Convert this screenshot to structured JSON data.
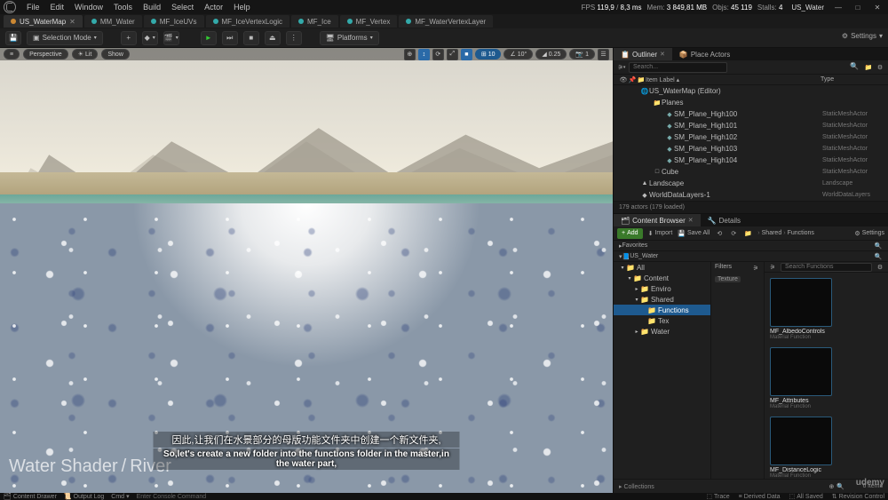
{
  "menubar": [
    "File",
    "Edit",
    "Window",
    "Tools",
    "Build",
    "Select",
    "Actor",
    "Help"
  ],
  "perf": {
    "fps": "119,9",
    "ms": "8,3 ms",
    "mem": "3 849,81 MB",
    "objs": "45 119",
    "stalls": "4",
    "project": "US_Water"
  },
  "win": {
    "min": "—",
    "max": "□",
    "close": "✕"
  },
  "tabs": [
    {
      "label": "US_WaterMap",
      "active": true,
      "dot": "orange"
    },
    {
      "label": "MM_Water",
      "dot": "teal"
    },
    {
      "label": "MF_IceUVs",
      "dot": "teal"
    },
    {
      "label": "MF_IceVertexLogic",
      "dot": "teal"
    },
    {
      "label": "MF_Ice",
      "dot": "teal"
    },
    {
      "label": "MF_Vertex",
      "dot": "teal"
    },
    {
      "label": "MF_WaterVertexLayer",
      "dot": "teal"
    }
  ],
  "toolbar": {
    "save_icon": "💾",
    "mode": "Selection Mode",
    "add": "+",
    "play": "►",
    "pause": "❚❚",
    "stop": "■",
    "step": "⏭",
    "eject": "⏏",
    "platforms": "Platforms",
    "three": "⋮",
    "settings": "Settings"
  },
  "viewport": {
    "menu": "≡",
    "perspective": "Perspective",
    "lit": "Lit",
    "show": "Show",
    "r_icons": [
      "⊕",
      "↕",
      "⟳",
      "⤢",
      "■"
    ],
    "r_vals": [
      "10",
      "",
      "10°",
      "0.25",
      "1"
    ],
    "r_tail": [
      "📷",
      "☰"
    ]
  },
  "outliner": {
    "tab1": "Outliner",
    "tab2": "Place Actors",
    "filter": "⚙",
    "search_ph": "Search...",
    "settings": "⚙",
    "new": "📁",
    "col_icons": [
      "👁",
      "📌",
      "📁"
    ],
    "col_label": "Item Label",
    "col_type": "Type",
    "rows": [
      {
        "ind": 30,
        "ico": "🌐",
        "name": "US_WaterMap (Editor)",
        "type": ""
      },
      {
        "ind": 44,
        "ico": "📁",
        "cls": "folder-ico",
        "name": "Planes",
        "type": ""
      },
      {
        "ind": 58,
        "ico": "◆",
        "cls": "mesh-ico",
        "name": "SM_Plane_High100",
        "type": "StaticMeshActor"
      },
      {
        "ind": 58,
        "ico": "◆",
        "cls": "mesh-ico",
        "name": "SM_Plane_High101",
        "type": "StaticMeshActor"
      },
      {
        "ind": 58,
        "ico": "◆",
        "cls": "mesh-ico",
        "name": "SM_Plane_High102",
        "type": "StaticMeshActor"
      },
      {
        "ind": 58,
        "ico": "◆",
        "cls": "mesh-ico",
        "name": "SM_Plane_High103",
        "type": "StaticMeshActor"
      },
      {
        "ind": 58,
        "ico": "◆",
        "cls": "mesh-ico",
        "name": "SM_Plane_High104",
        "type": "StaticMeshActor"
      },
      {
        "ind": 44,
        "ico": "□",
        "name": "Cube",
        "type": "StaticMeshActor"
      },
      {
        "ind": 30,
        "ico": "▲",
        "name": "Landscape",
        "type": "Landscape"
      },
      {
        "ind": 30,
        "ico": "◆",
        "name": "WorldDataLayers-1",
        "type": "WorldDataLayers"
      }
    ],
    "status": "179 actors (179 loaded)"
  },
  "cb": {
    "tab1": "Content Browser",
    "tab2": "Details",
    "add": "Add",
    "import": "Import",
    "save_all": "Save All",
    "settings": "Settings",
    "crumbs": [
      "Shared",
      "Functions"
    ],
    "fav": "Favorites",
    "root": "US_Water",
    "tree": [
      {
        "ind": 6,
        "arr": "▾",
        "name": "All"
      },
      {
        "ind": 14,
        "arr": "▾",
        "name": "Content"
      },
      {
        "ind": 22,
        "arr": "▸",
        "name": "Enviro"
      },
      {
        "ind": 22,
        "arr": "▾",
        "name": "Shared"
      },
      {
        "ind": 30,
        "arr": "",
        "name": "Functions",
        "sel": true
      },
      {
        "ind": 30,
        "arr": "",
        "name": "Tex"
      },
      {
        "ind": 22,
        "arr": "▸",
        "name": "Water"
      }
    ],
    "filters_label": "Filters",
    "filter_chip": "Texture",
    "asset_search": "Search Functions",
    "assets": [
      {
        "name": "MF_AlbedoControls",
        "type": "Material Function"
      },
      {
        "name": "MF_Attributes",
        "type": "Material Function"
      },
      {
        "name": "MF_DistanceLogic",
        "type": "Material Function"
      }
    ],
    "collections": "Collections",
    "count": "6 items"
  },
  "statusbar": {
    "drawer": "Content Drawer",
    "output": "Output Log",
    "cmd": "Cmd",
    "cmd_ph": "Enter Console Command",
    "trace": "Trace",
    "derived": "Derived Data",
    "saved": "All Saved",
    "rev": "Revision Control"
  },
  "watermark": {
    "a": "Water Shader",
    "b": "River"
  },
  "subtitle": {
    "cn": "因此,让我们在水景部分的母版功能文件夹中创建一个新文件夹,",
    "en": "So,let's create a new folder into the functions folder in the master,in the water part,"
  },
  "brand": "udemy"
}
